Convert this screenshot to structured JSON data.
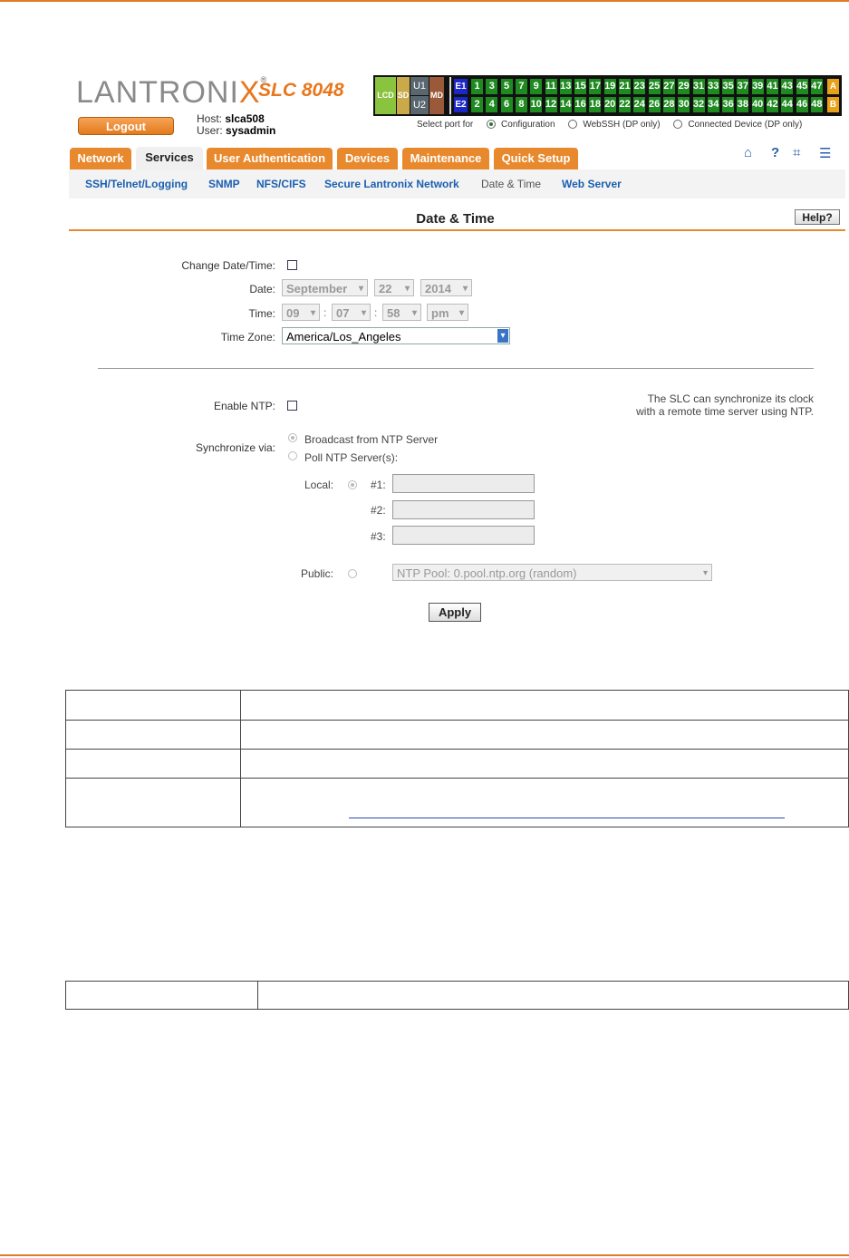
{
  "header": {
    "logo_main": "LANTRONI",
    "logo_x": "X",
    "logo_reg": "®",
    "model": "SLC 8048",
    "logout_label": "Logout",
    "host_label": "Host:",
    "host_value": "slca508",
    "user_label": "User:",
    "user_value": "sysadmin"
  },
  "port_panel": {
    "lcd": "LCD",
    "sd": "SD",
    "u1": "U1",
    "u2": "U2",
    "md": "MD",
    "e1": "E1",
    "e2": "E2",
    "a": "A",
    "b": "B",
    "odd_ports": [
      "1",
      "3",
      "5",
      "7",
      "9",
      "11",
      "13",
      "15",
      "17",
      "19",
      "21",
      "23",
      "25",
      "27",
      "29",
      "31",
      "33",
      "35",
      "37",
      "39",
      "41",
      "43",
      "45",
      "47"
    ],
    "even_ports": [
      "2",
      "4",
      "6",
      "8",
      "10",
      "12",
      "14",
      "16",
      "18",
      "20",
      "22",
      "24",
      "26",
      "28",
      "30",
      "32",
      "34",
      "36",
      "38",
      "40",
      "42",
      "44",
      "46",
      "48"
    ],
    "select_port_label": "Select port for",
    "options": [
      "Configuration",
      "WebSSH (DP only)",
      "Connected Device (DP only)"
    ],
    "selected_option": "Configuration"
  },
  "tabs": [
    "Network",
    "Services",
    "User Authentication",
    "Devices",
    "Maintenance",
    "Quick Setup"
  ],
  "active_tab": "Services",
  "subnav": [
    "SSH/Telnet/Logging",
    "SNMP",
    "NFS/CIFS",
    "Secure Lantronix Network",
    "Date & Time",
    "Web Server"
  ],
  "current_subnav": "Date & Time",
  "page_title": "Date & Time",
  "help_label": "Help?",
  "form": {
    "change_label": "Change Date/Time:",
    "date_label": "Date:",
    "month": "September",
    "day": "22",
    "year": "2014",
    "time_label": "Time:",
    "hour": "09",
    "minute": "07",
    "second": "58",
    "ampm": "pm",
    "sep1": ":",
    "sep2": ":",
    "tz_label": "Time Zone:",
    "tz_value": "America/Los_Angeles",
    "enable_ntp_label": "Enable NTP:",
    "ntp_note_line1": "The SLC can synchronize its clock",
    "ntp_note_line2": "with a remote time server using NTP.",
    "sync_label": "Synchronize via:",
    "broadcast_label": "Broadcast from NTP Server",
    "poll_label": "Poll NTP Server(s):",
    "local_label": "Local:",
    "server1_label": "#1:",
    "server2_label": "#2:",
    "server3_label": "#3:",
    "public_label": "Public:",
    "public_value": "NTP Pool: 0.pool.ntp.org (random)",
    "apply_label": "Apply"
  }
}
